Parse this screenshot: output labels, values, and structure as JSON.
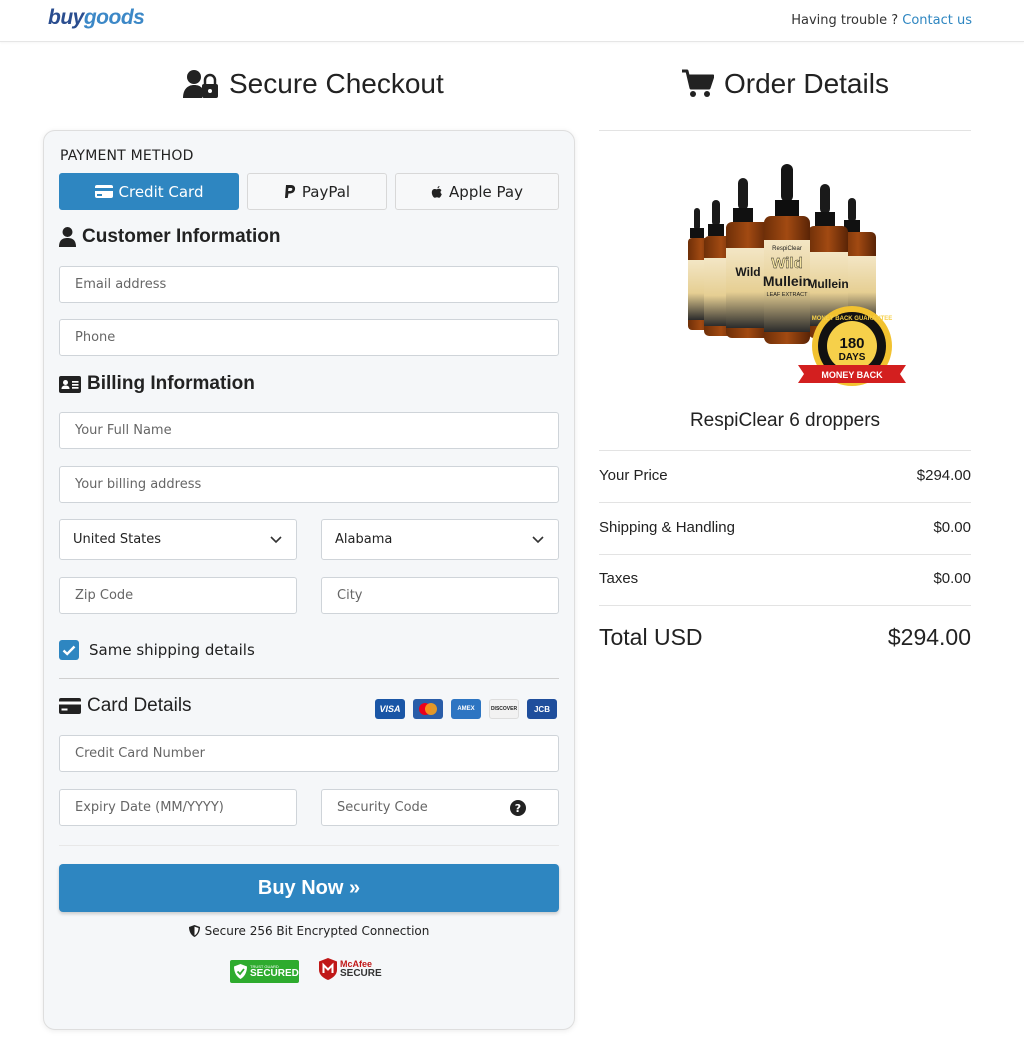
{
  "header": {
    "logo_buy": "buy",
    "logo_goods": "goods",
    "help_text": "Having trouble ? ",
    "contact_link": "Contact us"
  },
  "checkout": {
    "title": "Secure Checkout",
    "payment_method_label": "PAYMENT METHOD",
    "payment_methods": [
      {
        "label": "Credit Card",
        "icon": "credit-card-icon",
        "active": true
      },
      {
        "label": "PayPal",
        "icon": "paypal-icon",
        "active": false
      },
      {
        "label": "Apple Pay",
        "icon": "apple-icon",
        "active": false
      }
    ],
    "customer_info": {
      "title": "Customer Information",
      "email_placeholder": "Email address",
      "phone_placeholder": "Phone"
    },
    "billing_info": {
      "title": "Billing Information",
      "full_name_placeholder": "Your Full Name",
      "address_placeholder": "Your billing address",
      "country_value": "United States",
      "state_value": "Alabama",
      "zip_placeholder": "Zip Code",
      "city_placeholder": "City",
      "same_shipping_label": "Same shipping details",
      "same_shipping_checked": true
    },
    "card_details": {
      "title": "Card Details",
      "card_brands": [
        "VISA",
        "mastercard",
        "AMEX",
        "DISCOVER",
        "JCB"
      ],
      "card_number_placeholder": "Credit Card Number",
      "expiry_placeholder": "Expiry Date (MM/YYYY)",
      "security_code_placeholder": "Security Code",
      "security_help": "?"
    },
    "buy_button": "Buy Now »",
    "secure_text": "Secure 256 Bit Encrypted Connection",
    "badges": {
      "trustguard_small": "TRUST GUARD",
      "trustguard_big": "SECURED",
      "mcafee_line1": "McAfee",
      "mcafee_line2": "SECURE"
    }
  },
  "order": {
    "title": "Order Details",
    "product_name": "RespiClear 6 droppers",
    "product_label_brand": "RespiClear",
    "product_label_line1": "Wild",
    "product_label_line2": "Mullein",
    "product_label_line3": "LEAF EXTRACT",
    "seal_top": "MONEY BACK GUARANTEE",
    "seal_days": "180",
    "seal_days_label": "DAYS",
    "seal_ribbon": "MONEY BACK",
    "rows": [
      {
        "label": "Your Price",
        "value": "$294.00"
      },
      {
        "label": "Shipping & Handling",
        "value": "$0.00"
      },
      {
        "label": "Taxes",
        "value": "$0.00"
      }
    ],
    "total_label": "Total USD",
    "total_value": "$294.00"
  },
  "colors": {
    "accent": "#2e86c1",
    "logo_dark": "#2a4d8f",
    "logo_light": "#3c88c7"
  }
}
